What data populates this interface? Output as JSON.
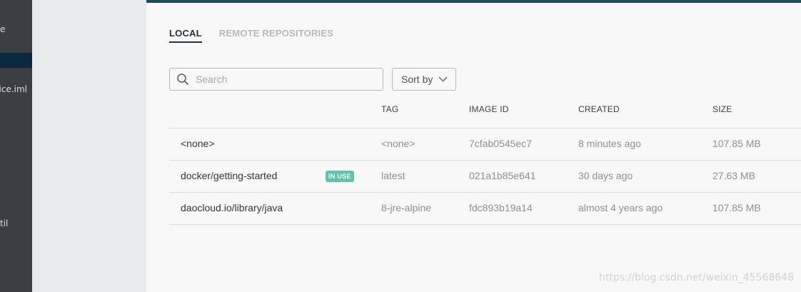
{
  "ide": {
    "line1": "e",
    "line2": "vice.iml",
    "line3": "til"
  },
  "tabs": [
    {
      "label": "LOCAL",
      "active": true
    },
    {
      "label": "REMOTE REPOSITORIES",
      "active": false
    }
  ],
  "search": {
    "placeholder": "Search",
    "value": ""
  },
  "sort": {
    "label": "Sort by"
  },
  "table": {
    "columns": [
      "TAG",
      "IMAGE ID",
      "CREATED",
      "SIZE"
    ],
    "rows": [
      {
        "name": "<none>",
        "badge": "",
        "tag": "<none>",
        "image_id": "7cfab0545ec7",
        "created": "8 minutes ago",
        "size": "107.85 MB"
      },
      {
        "name": "docker/getting-started",
        "badge": "IN USE",
        "tag": "latest",
        "image_id": "021a1b85e641",
        "created": "30 days ago",
        "size": "27.63 MB"
      },
      {
        "name": "daocloud.io/library/java",
        "badge": "",
        "tag": "8-jre-alpine",
        "image_id": "fdc893b19a14",
        "created": "almost 4 years ago",
        "size": "107.85 MB"
      }
    ]
  },
  "watermark": "https://blog.csdn.net/weixin_45568648",
  "colors": {
    "accent": "#234c5b",
    "badge": "#5fc4ae"
  }
}
